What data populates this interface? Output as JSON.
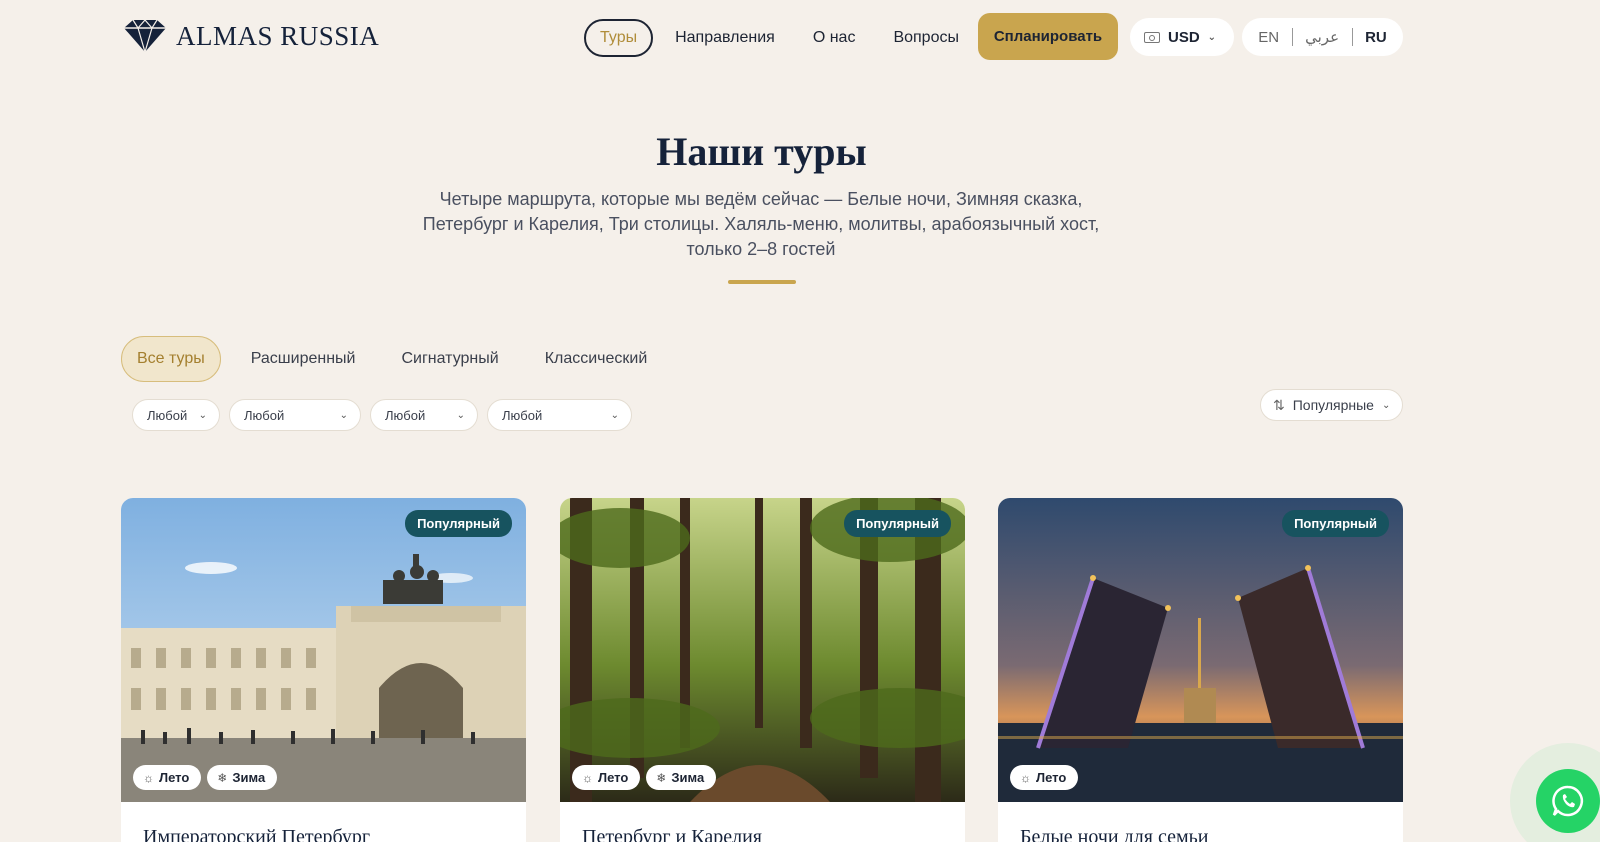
{
  "brand": {
    "name": "ALMAS RUSSIA"
  },
  "nav": {
    "items": [
      {
        "label": "Туры",
        "active": true
      },
      {
        "label": "Направления"
      },
      {
        "label": "О нас"
      },
      {
        "label": "Вопросы"
      }
    ],
    "cta_label": "Спланировать",
    "currency": "USD",
    "languages": [
      "EN",
      "عربي",
      "RU"
    ],
    "active_language": "RU"
  },
  "hero": {
    "title": "Наши туры",
    "subtitle": "Четыре маршрута, которые мы ведём сейчас — Белые ночи, Зимняя сказка, Петербург и Карелия, Три столицы. Халяль-меню, молитвы, арабоязычный хост, только 2–8 гостей"
  },
  "tiers": [
    {
      "label": "Все туры",
      "active": true
    },
    {
      "label": "Расширенный"
    },
    {
      "label": "Сигнатурный"
    },
    {
      "label": "Классический"
    }
  ],
  "filters": [
    "Любой",
    "Любой",
    "Любой",
    "Любой"
  ],
  "sort": {
    "label": "Популярные",
    "icon": "sort-arrows-icon"
  },
  "cards": [
    {
      "title": "Императорский Петербург",
      "badge": "Популярный",
      "seasons": [
        "Лето",
        "Зима"
      ]
    },
    {
      "title": "Петербург и Карелия",
      "badge": "Популярный",
      "seasons": [
        "Лето",
        "Зима"
      ]
    },
    {
      "title": "Белые ночи для семьи",
      "badge": "Популярный",
      "seasons": [
        "Лето"
      ]
    }
  ],
  "colors": {
    "background": "#f5f0ea",
    "gold": "#c9a54e",
    "navy": "#15223a",
    "badge": "#17535f",
    "whatsapp": "#25d366"
  },
  "icons": [
    "diamond-logo-icon",
    "money-icon",
    "chevron-down-icon",
    "sort-arrows-icon",
    "sun-icon",
    "snowflake-icon",
    "whatsapp-icon"
  ]
}
